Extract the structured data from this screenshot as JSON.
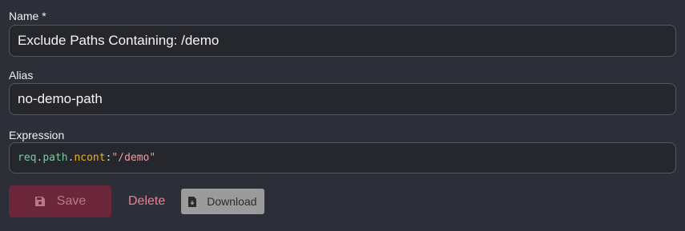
{
  "name_field": {
    "label": "Name *",
    "value": "Exclude Paths Containing: /demo"
  },
  "alias_field": {
    "label": "Alias",
    "value": "no-demo-path"
  },
  "expression_field": {
    "label": "Expression",
    "tokens": {
      "object": "req",
      "dot1": ".",
      "property": "path",
      "dot2": ".",
      "function": "ncont",
      "colon": ":",
      "string": "\"/demo\""
    }
  },
  "actions": {
    "save_label": "Save",
    "save_icon": "floppy-disk-icon",
    "delete_label": "Delete",
    "download_label": "Download",
    "download_icon": "file-download-icon"
  },
  "colors": {
    "background": "#2c2f38",
    "input_background": "#25272d",
    "save_button": "#6b2739",
    "delete_text": "#ef7f8f",
    "download_button": "#9b9b9b"
  }
}
